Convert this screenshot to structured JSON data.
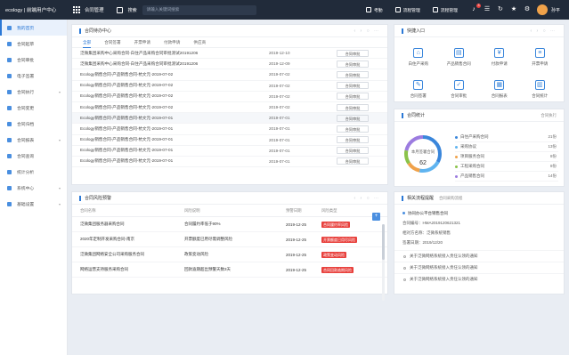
{
  "topbar": {
    "brand": "ecology | 前端用户中心",
    "module": "合同管理",
    "select": "搜索",
    "search_placeholder": "请输入关键词搜索",
    "items": [
      "考勤",
      "流程管理",
      "流程管理"
    ],
    "badge": "3",
    "user": "孙平"
  },
  "sidebar": {
    "items": [
      {
        "label": "我的首页",
        "active": true
      },
      {
        "label": "合同起草"
      },
      {
        "label": "合同审批"
      },
      {
        "label": "电子签署"
      },
      {
        "label": "合同执行",
        "caret": true
      },
      {
        "label": "合同变更"
      },
      {
        "label": "合同归档"
      },
      {
        "label": "合同报表",
        "caret": true
      },
      {
        "label": "合同查询"
      },
      {
        "label": "统计分析"
      },
      {
        "label": "系统中心",
        "caret": true
      },
      {
        "label": "基础设置",
        "caret": true
      }
    ]
  },
  "todo": {
    "title": "合同待办中心",
    "controls": "‹ › ○ ⋯",
    "tabs": [
      "全部",
      "合同签署",
      "开票申请",
      "付款申请",
      "供应商"
    ],
    "rows": [
      {
        "title": "泛微集团采购中心采购合同-白住产品采购合同审批测试20191206",
        "date": "2019-12-10",
        "btn": "合同审批"
      },
      {
        "title": "泛微集团采购中心采购合同-白住产品采购合同审批测试20191206",
        "date": "2019-12-09",
        "btn": "合同审批"
      },
      {
        "title": "Ecology销售合同-产品销售合同-杭文元-2019-07-02",
        "date": "2019-07-02",
        "btn": "合同审批"
      },
      {
        "title": "Ecology销售合同-产品销售合同-杭文元-2019-07-02",
        "date": "2019-07-02",
        "btn": "合同审批"
      },
      {
        "title": "Ecology销售合同-产品销售合同-杭文元-2019-07-02",
        "date": "2019-07-02",
        "btn": "合同审批"
      },
      {
        "title": "Ecology销售合同-产品销售合同-杭文元-2019-07-02",
        "date": "2019-07-02",
        "btn": "合同审批"
      },
      {
        "title": "Ecology销售合同-产品销售合同-杭文元-2019-07-01",
        "date": "2019-07-01",
        "btn": "合同审批"
      },
      {
        "title": "Ecology销售合同-产品销售合同-杭文元-2019-07-01",
        "date": "2019-07-01",
        "btn": "合同审批"
      },
      {
        "title": "Ecology销售合同-产品销售合同-杭文元-2019-07-01",
        "date": "2019-07-01",
        "btn": "合同审批"
      },
      {
        "title": "Ecology销售合同-产品销售合同-杭文元-2019-07-01",
        "date": "2019-07-01",
        "btn": "合同审批"
      },
      {
        "title": "Ecology销售合同-产品销售合同-杭文元-2019-07-01",
        "date": "2019-07-01",
        "btn": "合同审批"
      }
    ]
  },
  "risk": {
    "title": "合同风险预警",
    "controls": "‹ › ○ ⋯",
    "headers": [
      "合同名称",
      "风险说明",
      "预警日期",
      "风险类型"
    ],
    "rows": [
      {
        "name": "泛微集团服务器采购合同",
        "desc": "合同履约率低于90%",
        "date": "2019-12-25",
        "type": "合同履约率风险"
      },
      {
        "name": "2020年定制开发采购合同-南京",
        "desc": "开票额度已用尽需调整风险",
        "date": "2019-12-25",
        "type": "开票额度已用尽风险"
      },
      {
        "name": "泛微集团网络安全公司采购服务合同",
        "desc": "政策变动风险",
        "date": "2019-12-25",
        "type": "政策变动风险"
      },
      {
        "name": "网络运营支持服务采购合同",
        "desc": "回款逾期超出预警天数3天",
        "date": "2019-12-25",
        "type": "合同回款逾期风险"
      }
    ]
  },
  "quick": {
    "title": "快捷入口",
    "controls": "‹ › ○ ⋯",
    "items": [
      {
        "label": "白住产采购",
        "icon": "purchase-icon",
        "glyph": "⌂"
      },
      {
        "label": "产品销售合同",
        "icon": "sales-contract-icon",
        "glyph": "▤"
      },
      {
        "label": "付款申请",
        "icon": "payment-icon",
        "glyph": "¥"
      },
      {
        "label": "开票申请",
        "icon": "invoice-icon",
        "glyph": "≡"
      },
      {
        "label": "合同签署",
        "icon": "sign-icon",
        "glyph": "✎"
      },
      {
        "label": "合同审批",
        "icon": "approval-icon",
        "glyph": "✓"
      },
      {
        "label": "合同报表",
        "icon": "report-icon",
        "glyph": "▦"
      },
      {
        "label": "合同统计",
        "icon": "stats-icon",
        "glyph": "▥"
      }
    ]
  },
  "count": {
    "title": "合同统计",
    "link": "合同执行",
    "center_label": "本月签署合同",
    "center_value": "62",
    "items": [
      {
        "label": "白住产采购合同",
        "value": "21份",
        "color": "#3a86db"
      },
      {
        "label": "采购协议",
        "value": "13份",
        "color": "#5fb4f0"
      },
      {
        "label": "项目服务合同",
        "value": "8份",
        "color": "#f0a24a"
      },
      {
        "label": "工程采购合同",
        "value": "8份",
        "color": "#8bc34a"
      },
      {
        "label": "产品销售合同",
        "value": "14份",
        "color": "#9c7ce0"
      }
    ]
  },
  "warn": {
    "title": "相关流程提醒",
    "subtitle": "合同采购流程",
    "company_suffix": "协同办公平台销售合同",
    "lines": [
      "合同编号：HMA2019120621321",
      "相对方名称：泛微系统销售",
      "签署日期：2019/12/20"
    ],
    "notices": [
      "关于泛微网络系统接入责任认领的通知",
      "关于泛微网络系统接入责任认领的通知",
      "关于泛微网络系统接入责任认领的通知"
    ]
  }
}
